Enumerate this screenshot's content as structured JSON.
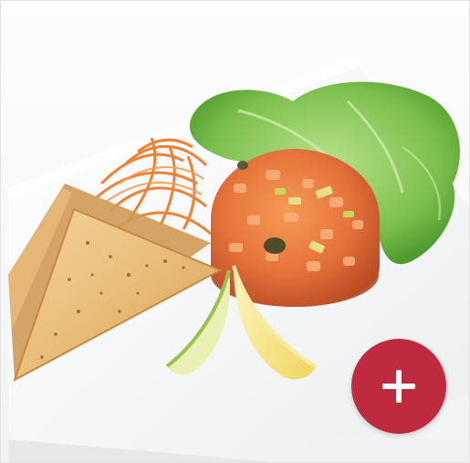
{
  "card": {
    "image_subject": "food-dish-photo",
    "add_button": {
      "icon": "plus-icon",
      "color": "#bf2a3e"
    }
  }
}
